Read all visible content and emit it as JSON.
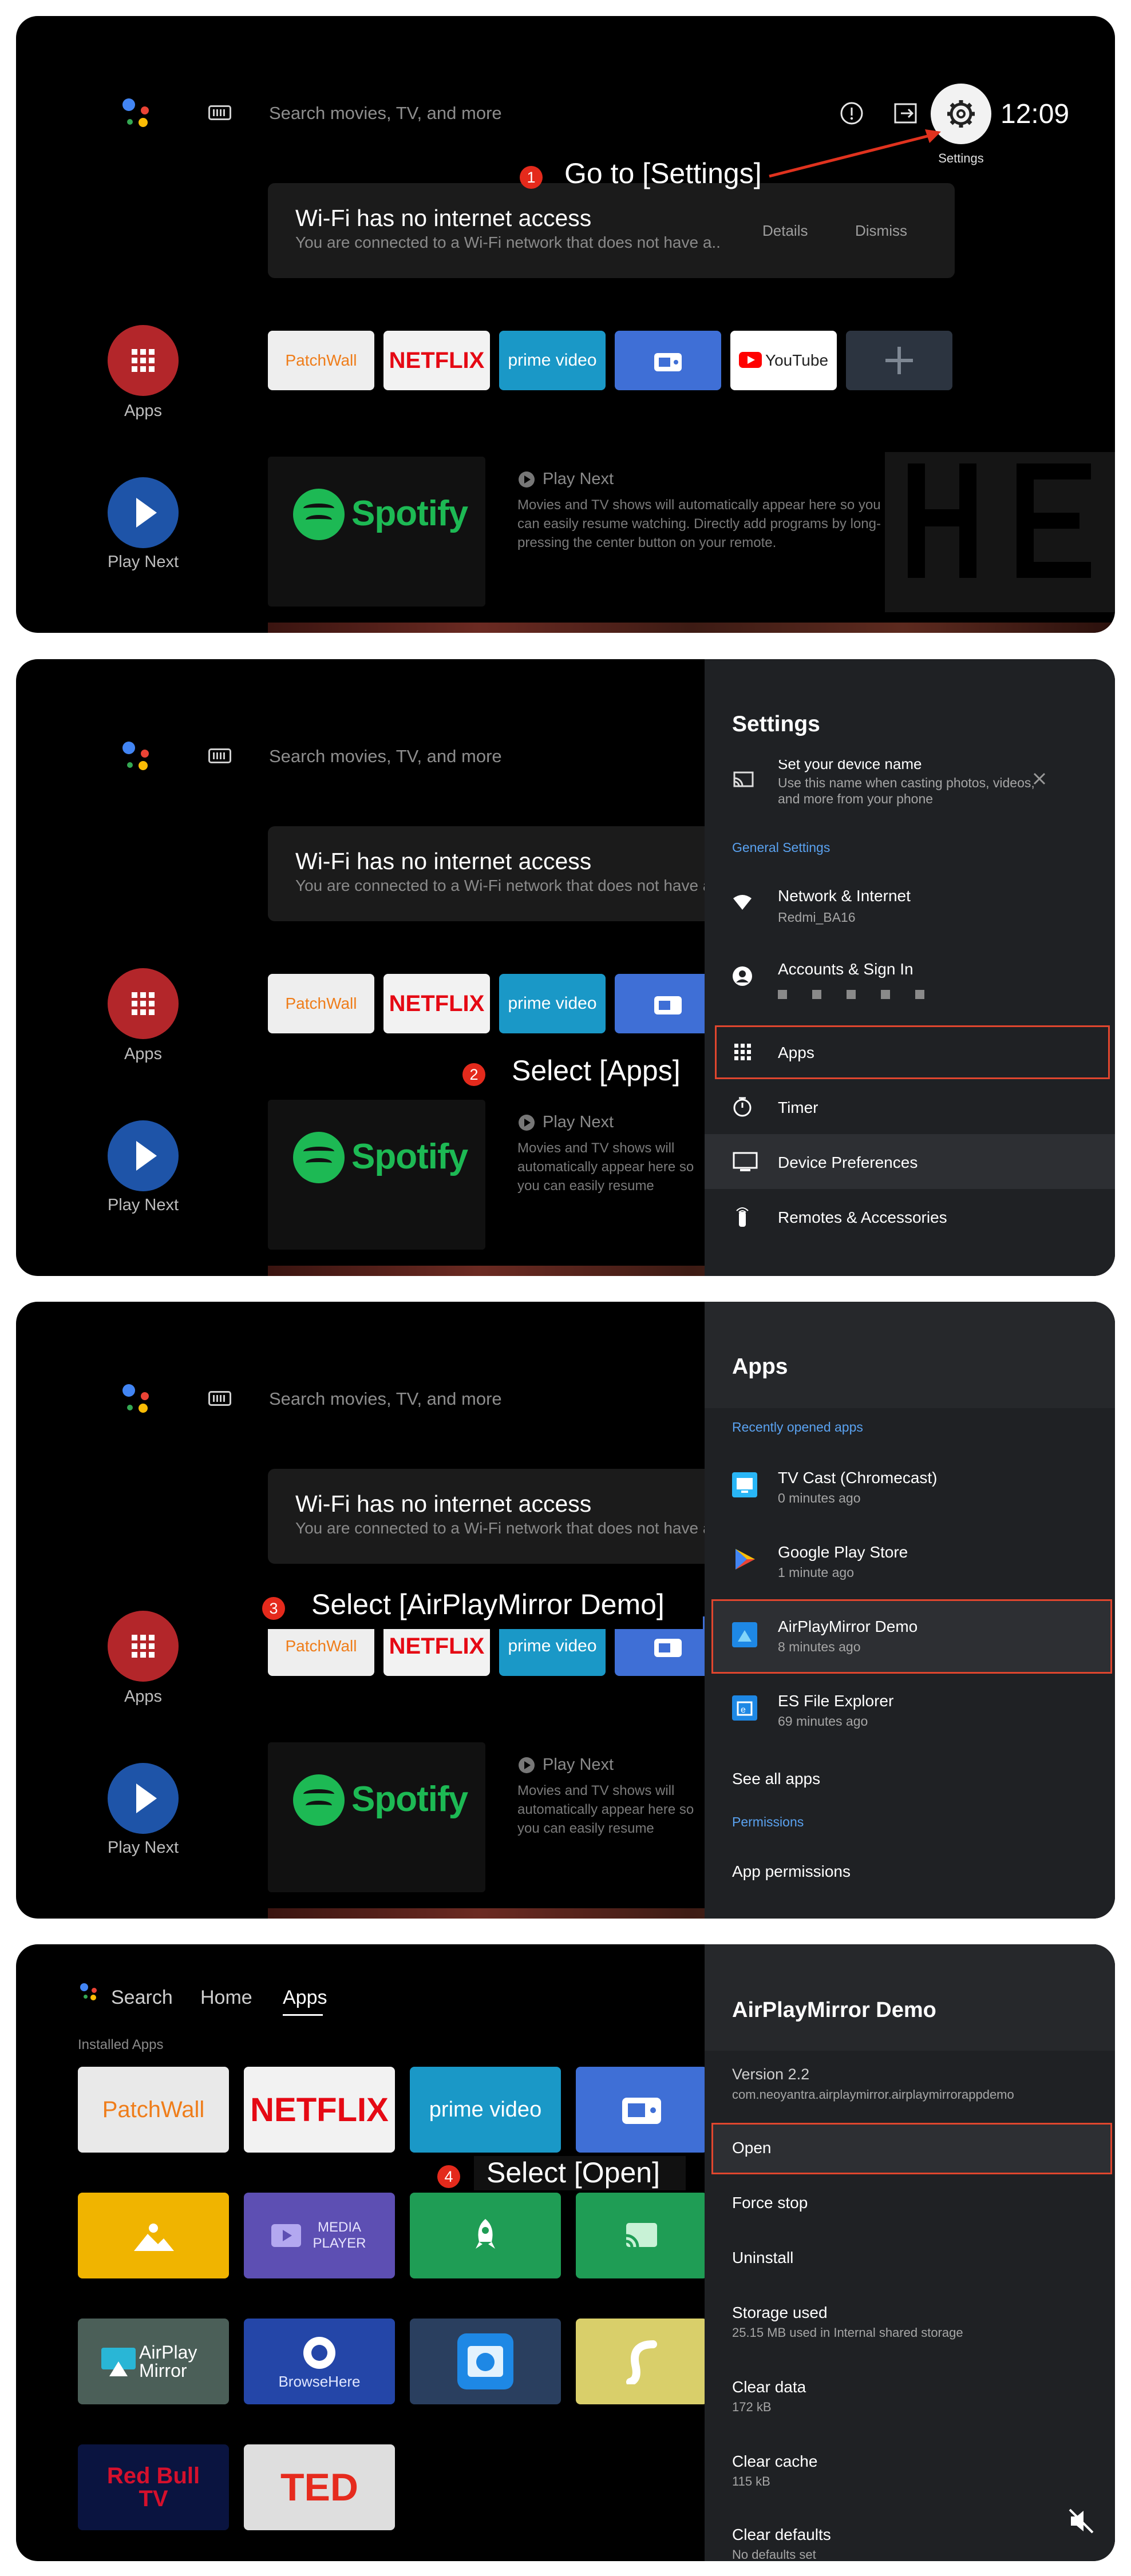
{
  "home": {
    "search_placeholder": "Search movies, TV, and more",
    "clock": "12:09",
    "settings_tooltip": "Settings",
    "toast_title": "Wi-Fi has no internet access",
    "toast_message": "You are connected to a Wi-Fi network that does not have a..",
    "toast_details": "Details",
    "toast_dismiss": "Dismiss",
    "apps_label": "Apps",
    "play_next_label": "Play Next",
    "tiles": [
      "PatchWall",
      "NETFLIX",
      "prime video",
      "YouTube"
    ],
    "spotify": "Spotify",
    "play_next_title": "Play Next",
    "play_next_desc": "Movies and TV shows will automatically appear here so you can easily resume watching. Directly add programs by long-pressing the center button on your remote."
  },
  "steps": [
    {
      "num": "1",
      "text": "Go to [Settings]"
    },
    {
      "num": "2",
      "text": "Select [Apps]"
    },
    {
      "num": "3",
      "text": "Select [AirPlayMirror Demo]"
    },
    {
      "num": "4",
      "text": "Select [Open]"
    }
  ],
  "settings_panel": {
    "title": "Settings",
    "device_name_title": "Set your device name",
    "device_name_sub": "Use this name when casting photos, videos, and more from your phone",
    "section": "General Settings",
    "network": "Network & Internet",
    "network_sub": "Redmi_BA16",
    "accounts": "Accounts & Sign In",
    "apps": "Apps",
    "timer": "Timer",
    "device_prefs": "Device Preferences",
    "remotes": "Remotes & Accessories"
  },
  "apps_panel": {
    "title": "Apps",
    "section": "Recently opened apps",
    "items": [
      {
        "name": "TV Cast (Chromecast)",
        "time": "0 minutes ago"
      },
      {
        "name": "Google Play Store",
        "time": "1 minute ago"
      },
      {
        "name": "AirPlayMirror Demo",
        "time": "8 minutes ago"
      },
      {
        "name": "ES File Explorer",
        "time": "69 minutes ago"
      }
    ],
    "see_all": "See all apps",
    "permissions_section": "Permissions",
    "app_permissions": "App permissions"
  },
  "app_detail": {
    "title": "AirPlayMirror Demo",
    "version": "Version 2.2",
    "package": "com.neoyantra.airplaymirror.airplaymirrorappdemo",
    "open": "Open",
    "force_stop": "Force stop",
    "uninstall": "Uninstall",
    "storage": "Storage used",
    "storage_sub": "25.15 MB used in Internal shared storage",
    "clear_data": "Clear data",
    "clear_data_sub": "172 kB",
    "clear_cache": "Clear cache",
    "clear_cache_sub": "115 kB",
    "clear_defaults": "Clear defaults",
    "clear_defaults_sub": "No defaults set"
  },
  "apps_screen": {
    "nav_search": "Search",
    "nav_home": "Home",
    "nav_apps": "Apps",
    "installed": "Installed Apps",
    "tiles": [
      "PatchWall",
      "NETFLIX",
      "prime video",
      "MEDIA PLAYER",
      "AirPlay Mirror",
      "BrowseHere",
      "Red Bull TV",
      "TED"
    ]
  }
}
